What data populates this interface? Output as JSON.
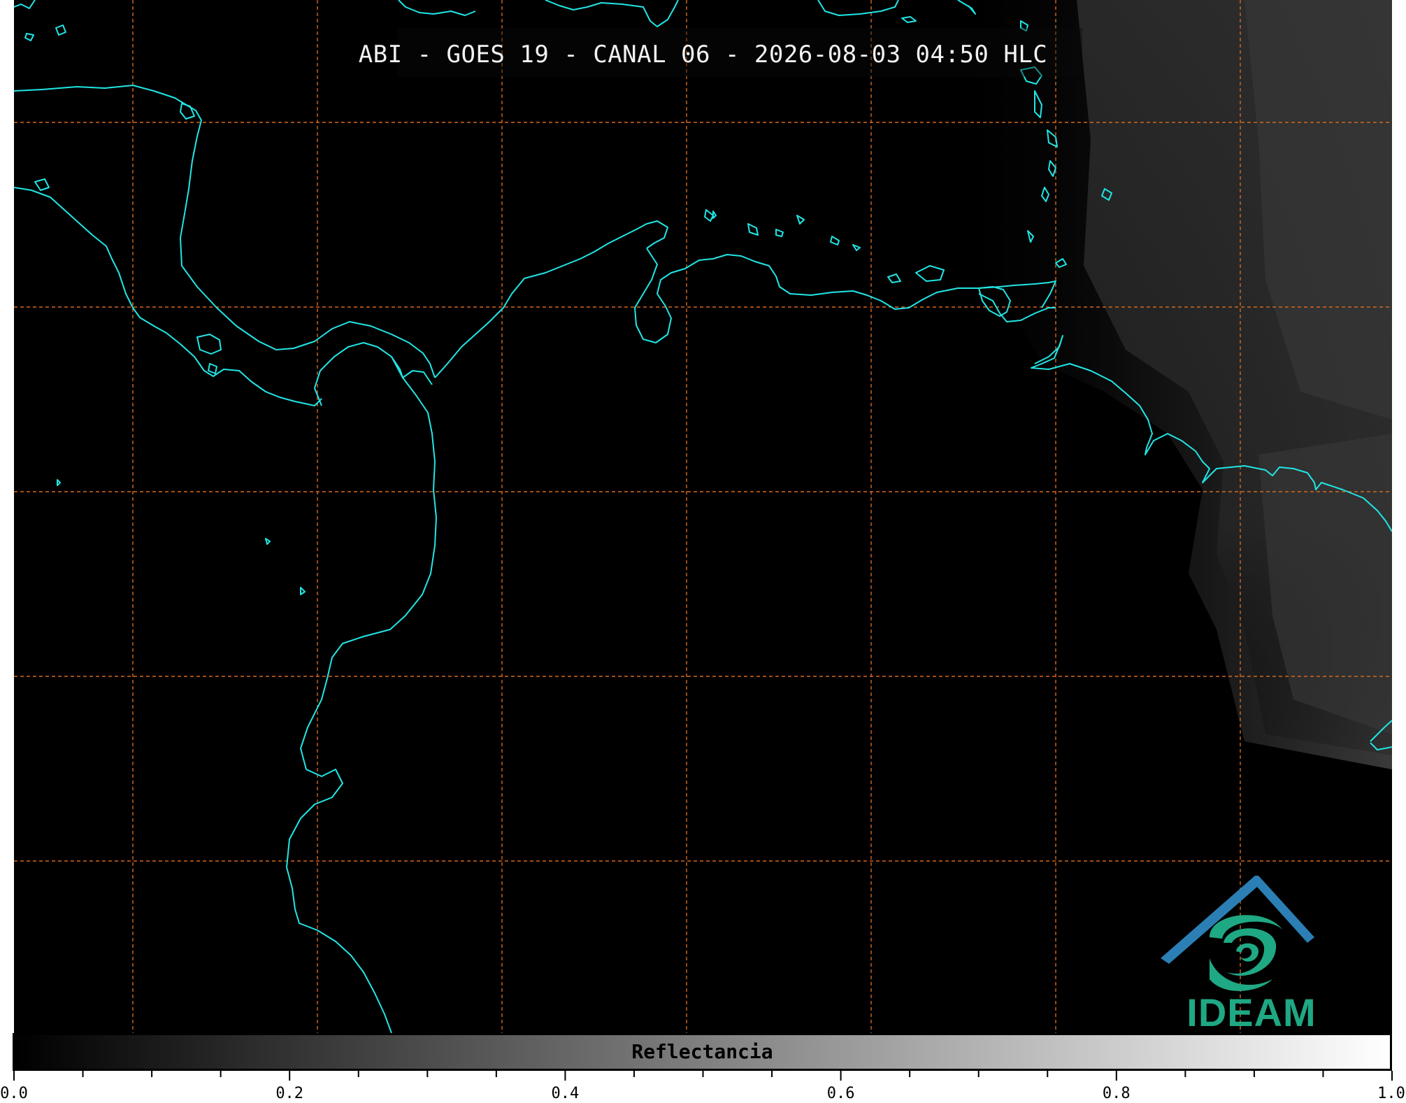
{
  "title": "ABI - GOES 19 - CANAL 06 - 2026-08-03 04:50 HLC",
  "colorbar": {
    "label": "Reflectancia",
    "min": 0.0,
    "max": 1.0,
    "tick_labels": [
      "0.0",
      "0.2",
      "0.4",
      "0.6",
      "0.8",
      "1.0"
    ],
    "tick_values": [
      0.0,
      0.2,
      0.4,
      0.6,
      0.8,
      1.0
    ],
    "minor_step": 0.05,
    "gradient_start": "#000000",
    "gradient_end": "#ffffff"
  },
  "map": {
    "background_color": "#000000",
    "coastline_color": "#22e5e5",
    "gridline_color": "#d2691e",
    "gridline_style": "dashed",
    "cloud_shading": "gray, increasing toward the east"
  },
  "logo": {
    "text": "IDEAM",
    "roof_color": "#2b7fb5",
    "swirl_color": "#1fa884"
  }
}
